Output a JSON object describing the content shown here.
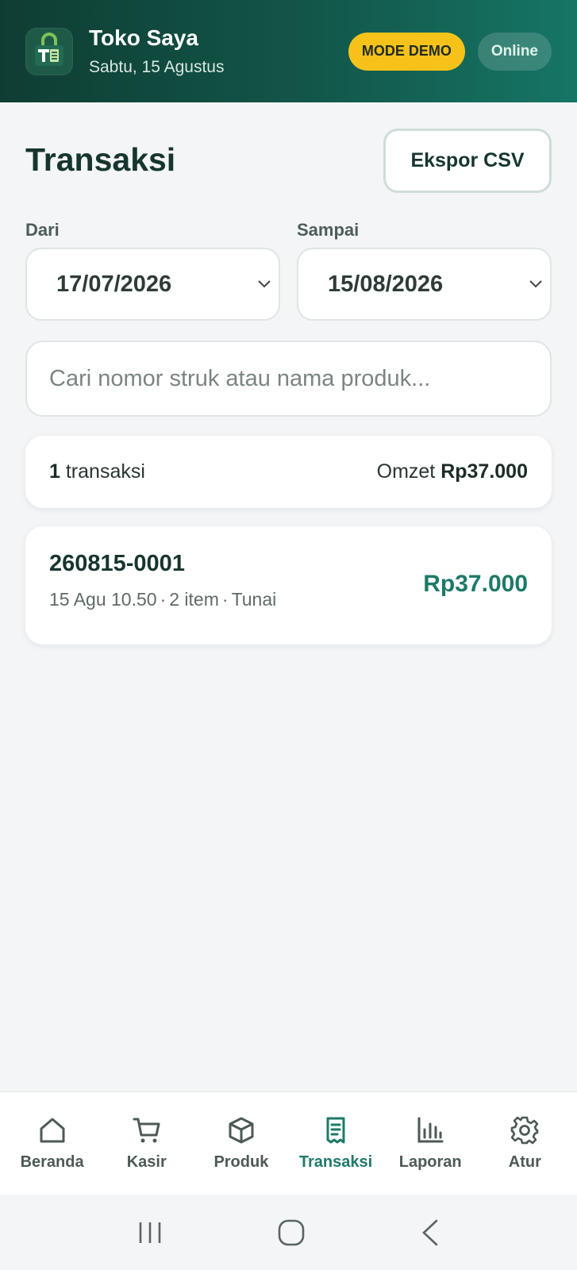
{
  "header": {
    "store_name": "Toko Saya",
    "date": "Sabtu, 15 Agustus",
    "demo_badge": "MODE DEMO",
    "status_badge": "Online"
  },
  "page": {
    "title": "Transaksi",
    "export_label": "Ekspor CSV"
  },
  "filters": {
    "from_label": "Dari",
    "from_value": "17/07/2026",
    "to_label": "Sampai",
    "to_value": "15/08/2026"
  },
  "search": {
    "placeholder": "Cari nomor struk atau nama produk..."
  },
  "summary": {
    "count": "1",
    "count_label": "transaksi",
    "revenue_label": "Omzet",
    "revenue_value": "Rp37.000"
  },
  "transactions": [
    {
      "number": "260815-0001",
      "time": "15 Agu 10.50",
      "items": "2 item",
      "payment": "Tunai",
      "amount": "Rp37.000"
    }
  ],
  "nav": {
    "items": [
      {
        "label": "Beranda",
        "icon": "home-icon"
      },
      {
        "label": "Kasir",
        "icon": "cart-icon"
      },
      {
        "label": "Produk",
        "icon": "box-icon"
      },
      {
        "label": "Transaksi",
        "icon": "receipt-icon",
        "active": true
      },
      {
        "label": "Laporan",
        "icon": "bar-chart-icon"
      },
      {
        "label": "Atur",
        "icon": "gear-icon"
      }
    ]
  },
  "colors": {
    "header_dark": "#0f3d33",
    "accent": "#1d7a68",
    "demo_badge": "#f6c21a"
  }
}
